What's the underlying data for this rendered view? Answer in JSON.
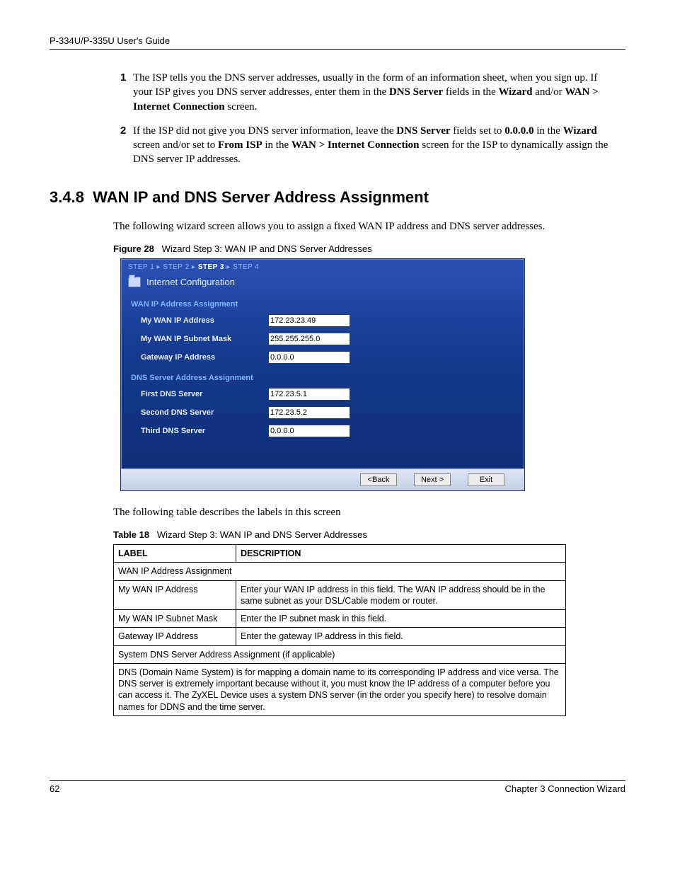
{
  "header": {
    "guide": "P-334U/P-335U User's Guide"
  },
  "list": {
    "item1_num": "1",
    "item1_html": "The ISP tells you the DNS server addresses, usually in the form of an information sheet, when you sign up. If your ISP gives you DNS server addresses, enter them in the <b>DNS Server</b> fields in the <b>Wizard</b> and/or <b>WAN > Internet Connection</b> screen.",
    "item2_num": "2",
    "item2_html": "If the ISP did not give you DNS server information, leave the <b>DNS Server</b> fields set to <b>0.0.0.0</b> in the <b>Wizard</b> screen and/or set to <b>From ISP</b> in the <b>WAN > Internet Connection</b> screen for the ISP to dynamically assign the DNS server IP addresses."
  },
  "section": {
    "number": "3.4.8",
    "title": "WAN IP and DNS Server Address Assignment",
    "intro": "The following wizard screen allows you to assign a fixed WAN IP address and DNS server addresses.",
    "after_fig": "The following table describes the labels in this screen"
  },
  "figure": {
    "label": "Figure 28",
    "caption": "Wizard Step 3: WAN IP and DNS Server Addresses"
  },
  "wizard": {
    "steps": [
      "STEP 1",
      "STEP 2",
      "STEP 3",
      "STEP 4"
    ],
    "active_step": 2,
    "sep": " ▸ ",
    "title": "Internet Configuration",
    "group1": "WAN IP Address Assignment",
    "fields1": [
      {
        "label": "My WAN IP Address",
        "value": "172.23.23.49"
      },
      {
        "label": "My WAN IP Subnet Mask",
        "value": "255.255.255.0"
      },
      {
        "label": "Gateway IP Address",
        "value": "0.0.0.0"
      }
    ],
    "group2": "DNS Server Address Assignment",
    "fields2": [
      {
        "label": "First DNS Server",
        "value": "172.23.5.1"
      },
      {
        "label": "Second DNS Server",
        "value": "172.23.5.2"
      },
      {
        "label": "Third DNS Server",
        "value": "0.0.0.0"
      }
    ],
    "buttons": {
      "back": "<Back",
      "next": "Next >",
      "exit": "Exit"
    }
  },
  "table": {
    "label": "Table 18",
    "caption": "Wizard Step 3: WAN IP and DNS Server Addresses",
    "head_label": "LABEL",
    "head_desc": "DESCRIPTION",
    "rows": [
      {
        "span": true,
        "text": "WAN IP Address Assignment"
      },
      {
        "label": "My WAN IP Address",
        "desc": "Enter your WAN IP address in this field. The WAN IP address should be in the same subnet as your DSL/Cable modem or router."
      },
      {
        "label": "My WAN IP Subnet Mask",
        "desc": "Enter the IP subnet mask in this field."
      },
      {
        "label": "Gateway IP Address",
        "desc": "Enter the gateway IP address in this field."
      },
      {
        "span": true,
        "text": "System DNS Server Address Assignment (if applicable)"
      },
      {
        "span": true,
        "text": "DNS (Domain Name System) is for mapping a domain name to its corresponding IP address and vice versa. The DNS server is extremely important because without it, you must know the IP address of a computer before you can access it. The ZyXEL Device uses a system DNS server (in the order you specify here) to resolve domain names for DDNS and the time server."
      }
    ]
  },
  "footer": {
    "page": "62",
    "chapter": "Chapter 3 Connection Wizard"
  }
}
